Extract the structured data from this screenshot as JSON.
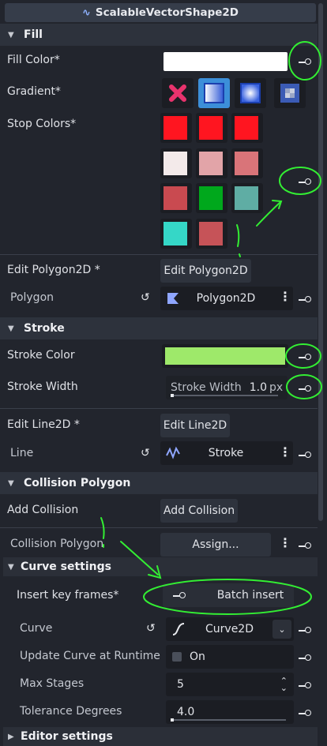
{
  "inspector_title": "ScalableVectorShape2D",
  "sections": {
    "fill": "Fill",
    "stroke": "Stroke",
    "collision": "Collision Polygon",
    "curve": "Curve settings",
    "editor": "Editor settings"
  },
  "fill": {
    "fill_color_label": "Fill Color*",
    "fill_color": "#ffffff",
    "gradient_label": "Gradient*",
    "stop_colors_label": "Stop Colors*",
    "stop_colors": [
      "#ff1520",
      "#ff1520",
      "#ff1520",
      "#f3eaea",
      "#e2a4a8",
      "#d97479",
      "#c94a50",
      "#00a81c",
      "#5fada4",
      "#35d7c7",
      "#c65358"
    ]
  },
  "polygon": {
    "edit_label": "Edit Polygon2D *",
    "edit_button": "Edit Polygon2D",
    "prop_label": "Polygon",
    "resource": "Polygon2D"
  },
  "stroke": {
    "color_label": "Stroke Color",
    "color": "#9ee96a",
    "width_label": "Stroke Width",
    "width_field_label": "Stroke Width",
    "width_value": "1.0",
    "width_unit": "px"
  },
  "line": {
    "edit_label": "Edit Line2D *",
    "edit_button": "Edit Line2D",
    "prop_label": "Line",
    "resource": "Stroke"
  },
  "collision": {
    "add_label": "Add Collision",
    "add_button": "Add Collision",
    "polygon_label": "Collision Polygon",
    "assign_button": "Assign..."
  },
  "curve": {
    "insert_label": "Insert key frames*",
    "batch_button": "Batch insert",
    "curve_label": "Curve",
    "curve_resource": "Curve2D",
    "runtime_label": "Update Curve at Runtime",
    "runtime_value": "On",
    "runtime_checked": false,
    "max_stages_label": "Max Stages",
    "max_stages_value": "5",
    "tolerance_label": "Tolerance Degrees",
    "tolerance_value": "4.0"
  },
  "colors": {
    "accent": "#4aa3ff",
    "annotation": "#33ee33",
    "background": "#22252d"
  }
}
